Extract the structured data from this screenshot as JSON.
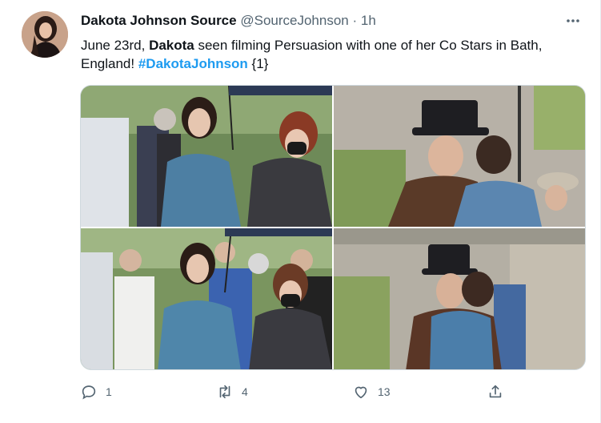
{
  "tweet": {
    "author_name": "Dakota Johnson Source",
    "handle": "@SourceJohnson",
    "separator": "·",
    "time": "1h",
    "more_icon": "more-icon",
    "text_part1": "June 23rd, ",
    "text_bold": "Dakota",
    "text_part2": " seen filming Persuasion with one of her Co Stars in Bath, England! ",
    "hashtag": "#DakotaJohnson",
    "text_part3": " {1}"
  },
  "actions": {
    "reply_count": "1",
    "retweet_count": "4",
    "like_count": "13",
    "icons": [
      "reply-icon",
      "retweet-icon",
      "like-icon",
      "share-icon"
    ]
  },
  "colors": {
    "link": "#1d9bf0",
    "muted": "#536471",
    "text": "#0f1419"
  }
}
